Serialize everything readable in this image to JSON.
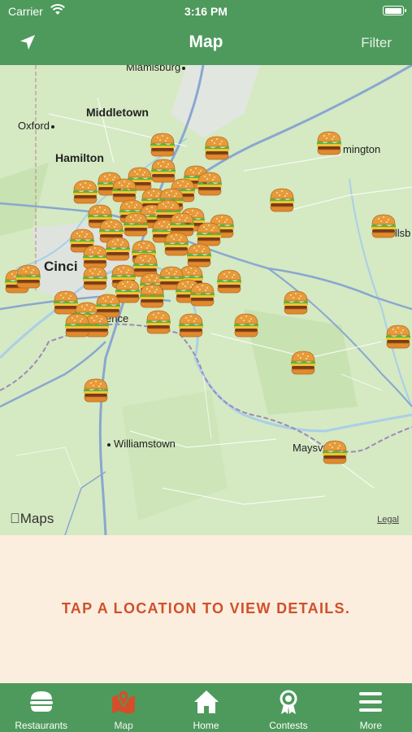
{
  "status": {
    "carrier": "Carrier",
    "time": "3:16 PM",
    "battery_level": 1.0
  },
  "nav": {
    "title": "Map",
    "filter_label": "Filter",
    "location_icon": "location-arrow-icon"
  },
  "map": {
    "towns": [
      {
        "key": "miamisburg",
        "label": "Miamisburg"
      },
      {
        "key": "middletown",
        "label": "Middletown"
      },
      {
        "key": "oxford",
        "label": "Oxford"
      },
      {
        "key": "hamilton",
        "label": "Hamilton"
      },
      {
        "key": "wilmington",
        "label": "mington"
      },
      {
        "key": "hillsboro",
        "label": "illsb"
      },
      {
        "key": "cincinnati",
        "label": "Cinci"
      },
      {
        "key": "florence",
        "label": "ence"
      },
      {
        "key": "williamstown",
        "label": "Williamstown"
      },
      {
        "key": "maysville",
        "label": "Maysv"
      }
    ],
    "marker_icon": "hamburger-icon",
    "attribution": "Maps",
    "legal": "Legal"
  },
  "info": {
    "hint": "TAP A LOCATION TO VIEW DETAILS."
  },
  "tabs": [
    {
      "label": "Restaurants",
      "icon": "burger-icon",
      "active": false
    },
    {
      "label": "Map",
      "icon": "map-pin-icon",
      "active": true
    },
    {
      "label": "Home",
      "icon": "home-icon",
      "active": false
    },
    {
      "label": "Contests",
      "icon": "award-ribbon-icon",
      "active": false
    },
    {
      "label": "More",
      "icon": "menu-icon",
      "active": false
    }
  ],
  "colors": {
    "brand_green": "#4e9a5c",
    "accent_red": "#d1502a",
    "panel_cream": "#fbeede",
    "active_tab": "#d1502a"
  }
}
